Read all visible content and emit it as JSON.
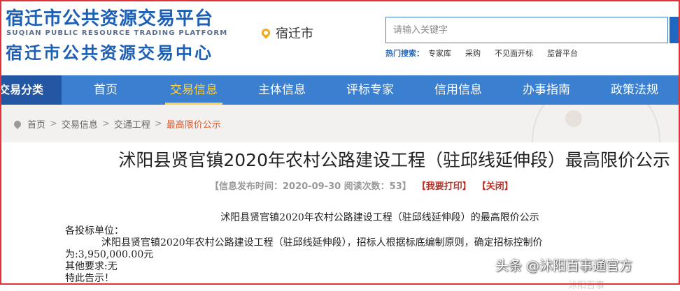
{
  "header": {
    "logo_cn_top": "宿迁市公共资源交易平台",
    "logo_en": "SUQIAN PUBLIC RESOURCE TRADING PLATFORM",
    "logo_cn_bottom": "宿迁市公共资源交易中心",
    "location": "宿迁市",
    "search_placeholder": "请输入关键字",
    "hot_label": "热门搜索：",
    "hot_links": [
      "专家库",
      "采购",
      "不见面开标",
      "监督平台"
    ]
  },
  "nav": {
    "category": "交易分类",
    "items": [
      "首页",
      "交易信息",
      "主体信息",
      "评标专家",
      "信用信息",
      "办事指南",
      "政策法规"
    ],
    "active_index": 1
  },
  "breadcrumb": {
    "items": [
      "首页",
      "交易信息",
      "交通工程"
    ],
    "current": "最高限价公示",
    "separator": ">"
  },
  "article": {
    "title": "沭阳县贤官镇2020年农村公路建设工程（驻邱线延伸段）最高限价公示",
    "meta_text": "【信息发布时间：2020-09-30  阅读次数：53】",
    "print_label": "【我要打印】",
    "close_label": "【关闭】",
    "body_heading": "沭阳县贤官镇2020年农村公路建设工程（驻邱线延伸段）的最高限价公示",
    "body_salutation": "各投标单位：",
    "body_paragraph": "沭阳县贤官镇2020年农村公路建设工程（驻邱线延伸段），招标人根据标底编制原则，确定招标控制价",
    "body_amount": "为:3,950,000.00元",
    "body_other": "其他要求:无",
    "body_notice": "特此告示！"
  },
  "watermark": {
    "text": "头条 @沭阳百事通官方",
    "faint_text": "沭阳百事"
  },
  "colors": {
    "brand_blue": "#1c5fb4",
    "nav_blue": "#3b7fd0",
    "nav_dark": "#2457a3",
    "active_yellow": "#ffd24a",
    "breadcrumb_orange": "#e05a2b",
    "frame_red": "#e0343a"
  },
  "icons": {
    "location": "map-pin-icon",
    "breadcrumb_home": "map-pin-icon"
  }
}
